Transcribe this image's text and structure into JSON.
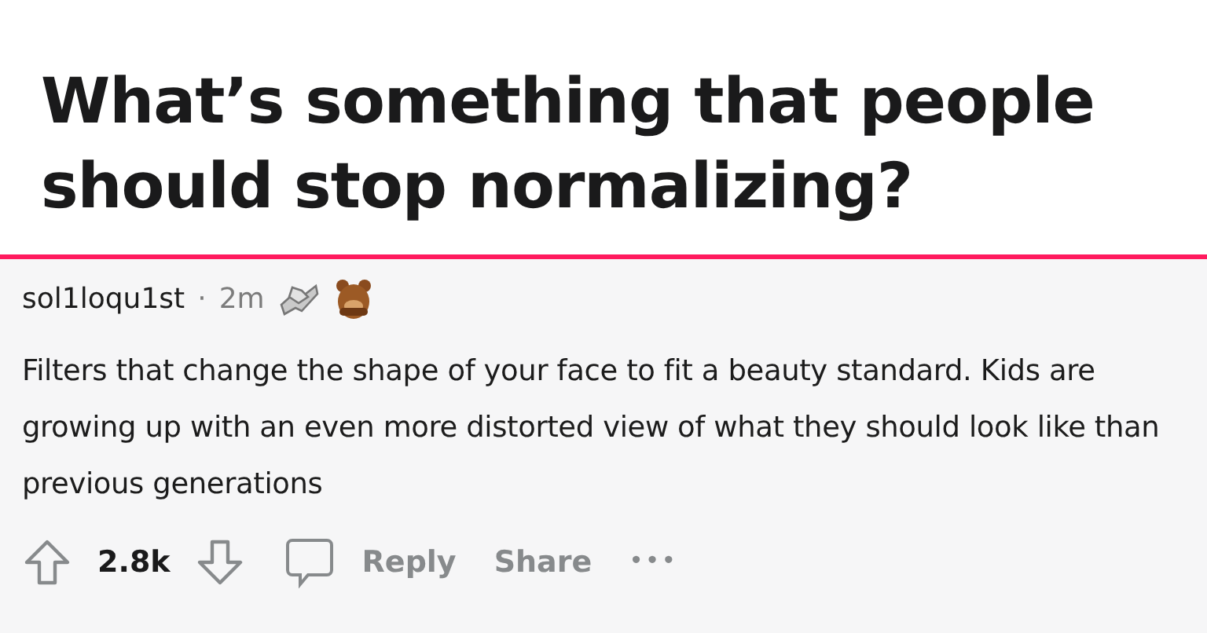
{
  "post": {
    "title": "What’s something that people should stop normalizing?"
  },
  "comment": {
    "author": "sol1loqu1st",
    "separator": "·",
    "time": "2m",
    "body": "Filters that change the shape of your face to fit a beauty standard. Kids are growing up with an even more distorted view of what they should look like than previous generations",
    "votes": "2.8k",
    "actions": [
      {
        "kind": "reply",
        "label": "Reply"
      },
      {
        "kind": "share",
        "label": "Share"
      },
      {
        "kind": "more",
        "label": "•••"
      }
    ]
  }
}
